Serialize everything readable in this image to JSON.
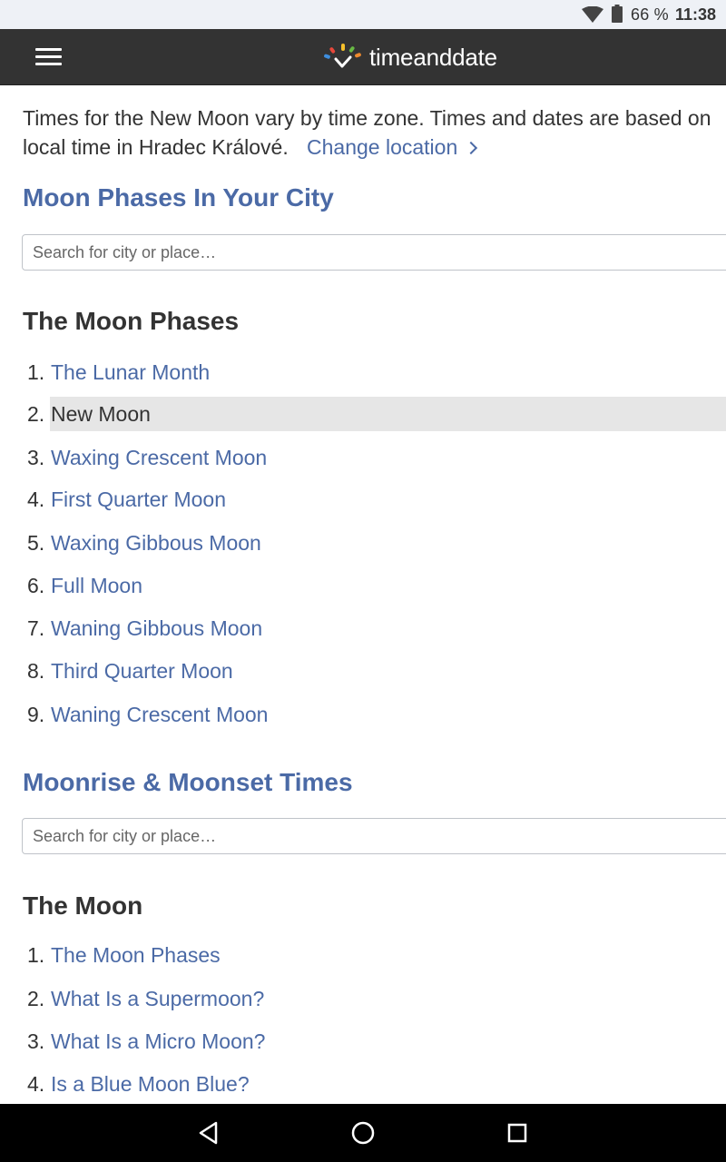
{
  "status_bar": {
    "battery": "66 %",
    "time": "11:38",
    "icons": [
      "wifi-icon",
      "battery-icon"
    ]
  },
  "app_bar": {
    "logo_text": "timeanddate",
    "icons": [
      "menu-icon",
      "logo-mark-icon"
    ]
  },
  "intro": {
    "text": "Times for the New Moon vary by time zone. Times and dates are based on local time in Hradec Králové.",
    "change_location": "Change location"
  },
  "moon_phases_city": {
    "heading": "Moon Phases In Your City",
    "search_placeholder": "Search for city or place…"
  },
  "moon_phases": {
    "title": "The Moon Phases",
    "current_index": 1,
    "items": [
      {
        "num": "1.",
        "label": "The Lunar Month"
      },
      {
        "num": "2.",
        "label": "New Moon"
      },
      {
        "num": "3.",
        "label": "Waxing Crescent Moon"
      },
      {
        "num": "4.",
        "label": "First Quarter Moon"
      },
      {
        "num": "5.",
        "label": "Waxing Gibbous Moon"
      },
      {
        "num": "6.",
        "label": "Full Moon"
      },
      {
        "num": "7.",
        "label": "Waning Gibbous Moon"
      },
      {
        "num": "8.",
        "label": "Third Quarter Moon"
      },
      {
        "num": "9.",
        "label": "Waning Crescent Moon"
      }
    ]
  },
  "moonrise": {
    "heading": "Moonrise & Moonset Times",
    "search_placeholder": "Search for city or place…"
  },
  "the_moon": {
    "title": "The Moon",
    "items": [
      {
        "num": "1.",
        "label": "The Moon Phases"
      },
      {
        "num": "2.",
        "label": "What Is a Supermoon?"
      },
      {
        "num": "3.",
        "label": "What Is a Micro Moon?"
      },
      {
        "num": "4.",
        "label": "Is a Blue Moon Blue?"
      }
    ]
  },
  "nav_bar": {
    "icons": [
      "back-icon",
      "home-icon",
      "recents-icon"
    ]
  },
  "colors": {
    "link": "#4b6aa6",
    "text": "#333333",
    "app_bar": "#333333",
    "highlight": "#e6e6e6"
  }
}
